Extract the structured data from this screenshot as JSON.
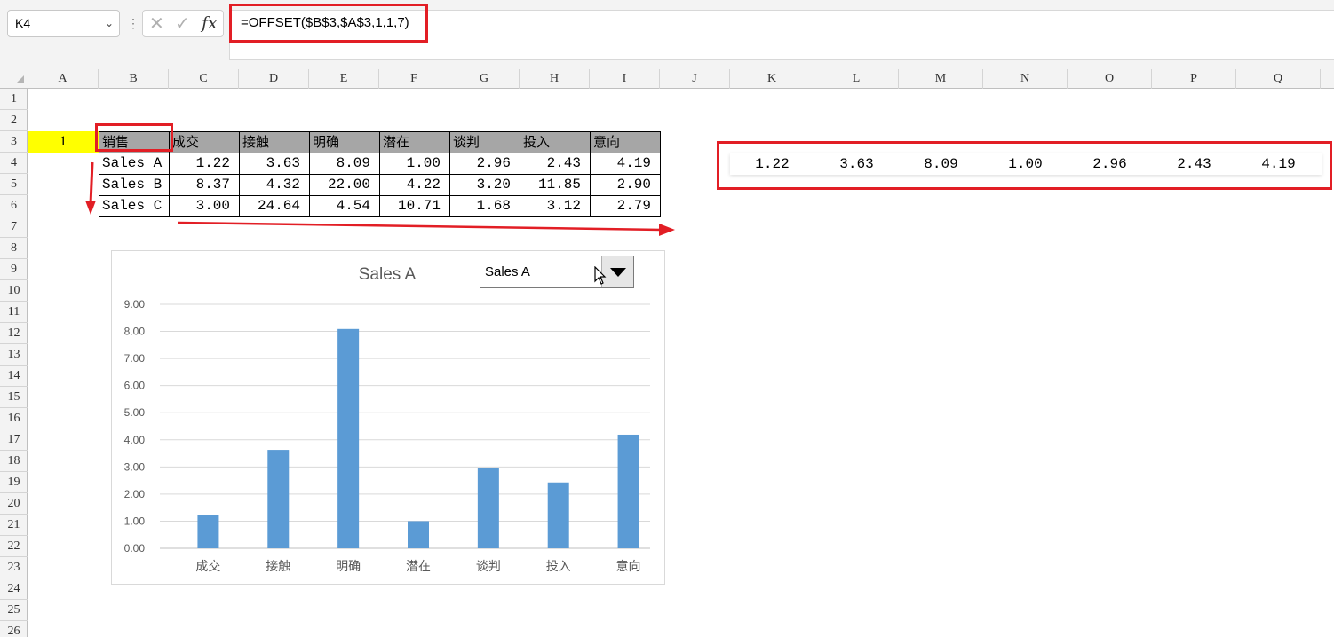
{
  "name_box": {
    "value": "K4"
  },
  "formula_bar": {
    "formula": "=OFFSET($B$3,$A$3,1,1,7)"
  },
  "icons": {
    "cancel": "x-icon",
    "enter": "check-icon",
    "function": "fx-icon"
  },
  "columns": [
    "A",
    "B",
    "C",
    "D",
    "E",
    "F",
    "G",
    "H",
    "I",
    "J",
    "K",
    "L",
    "M",
    "N",
    "O",
    "P",
    "Q"
  ],
  "rows": [
    "1",
    "2",
    "3",
    "4",
    "5",
    "6",
    "7",
    "8",
    "9",
    "10",
    "11",
    "12",
    "13",
    "14",
    "15",
    "16",
    "17",
    "18",
    "19",
    "20",
    "21",
    "22",
    "23",
    "24",
    "25",
    "26"
  ],
  "sheet": {
    "a3": "1",
    "headers": [
      "销售",
      "成交",
      "接触",
      "明确",
      "潜在",
      "谈判",
      "投入",
      "意向"
    ],
    "data": [
      [
        "Sales A",
        "1.22",
        "3.63",
        "8.09",
        "1.00",
        "2.96",
        "2.43",
        "4.19"
      ],
      [
        "Sales B",
        "8.37",
        "4.32",
        "22.00",
        "4.22",
        "3.20",
        "11.85",
        "2.90"
      ],
      [
        "Sales C",
        "3.00",
        "24.64",
        "4.54",
        "10.71",
        "1.68",
        "3.12",
        "2.79"
      ]
    ]
  },
  "result_row": [
    "1.22",
    "3.63",
    "8.09",
    "1.00",
    "2.96",
    "2.43",
    "4.19"
  ],
  "dropdown": {
    "selected": "Sales A"
  },
  "colors": {
    "bar": "#5b9bd5",
    "highlight": "#e21e25",
    "a3_fill": "#ffff00",
    "header_fill": "#a6a6a6"
  },
  "chart_data": {
    "type": "bar",
    "title": "Sales A",
    "categories": [
      "成交",
      "接触",
      "明确",
      "潜在",
      "谈判",
      "投入",
      "意向"
    ],
    "values": [
      1.22,
      3.63,
      8.09,
      1.0,
      2.96,
      2.43,
      4.19
    ],
    "ylim": [
      0,
      9
    ],
    "yticks": [
      "0.00",
      "1.00",
      "2.00",
      "3.00",
      "4.00",
      "5.00",
      "6.00",
      "7.00",
      "8.00",
      "9.00"
    ],
    "grid": true,
    "legend": "none",
    "xlabel": "",
    "ylabel": ""
  }
}
